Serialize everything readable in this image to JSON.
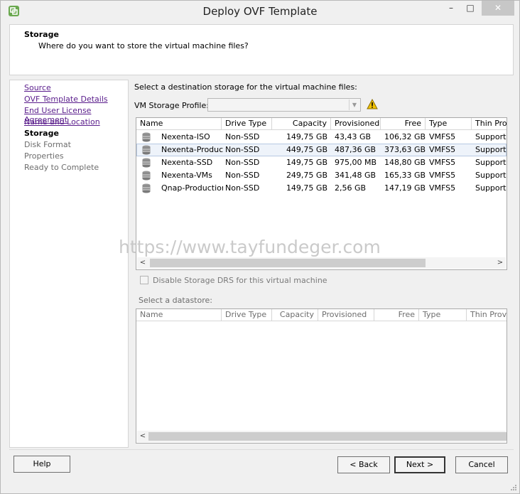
{
  "window": {
    "title": "Deploy OVF Template",
    "minimize": "–",
    "maximize": "□",
    "close": "✕"
  },
  "header": {
    "title": "Storage",
    "subtitle": "Where do you want to store the virtual machine files?"
  },
  "nav": {
    "items": [
      {
        "label": "Source",
        "state": "link"
      },
      {
        "label": "OVF Template Details",
        "state": "link"
      },
      {
        "label": "End User License Agreement",
        "state": "link"
      },
      {
        "label": "Name and Location",
        "state": "link"
      },
      {
        "label": "Storage",
        "state": "current"
      },
      {
        "label": "Disk Format",
        "state": "future"
      },
      {
        "label": "Properties",
        "state": "future"
      },
      {
        "label": "Ready to Complete",
        "state": "future"
      }
    ]
  },
  "main": {
    "prompt": "Select a destination storage for the virtual machine files:",
    "profile_label": "VM Storage Profile:",
    "profile_value": "",
    "columns": [
      "Name",
      "Drive Type",
      "Capacity",
      "Provisioned",
      "Free",
      "Type",
      "Thin Prov"
    ],
    "rows": [
      {
        "name": "Nexenta-ISO",
        "drive": "Non-SSD",
        "capacity": "149,75 GB",
        "provisioned": "43,43 GB",
        "free": "106,32 GB",
        "type": "VMFS5",
        "thin": "Supported"
      },
      {
        "name": "Nexenta-Production",
        "drive": "Non-SSD",
        "capacity": "449,75 GB",
        "provisioned": "487,36 GB",
        "free": "373,63 GB",
        "type": "VMFS5",
        "thin": "Supported"
      },
      {
        "name": "Nexenta-SSD",
        "drive": "Non-SSD",
        "capacity": "149,75 GB",
        "provisioned": "975,00 MB",
        "free": "148,80 GB",
        "type": "VMFS5",
        "thin": "Supported"
      },
      {
        "name": "Nexenta-VMs",
        "drive": "Non-SSD",
        "capacity": "249,75 GB",
        "provisioned": "341,48 GB",
        "free": "165,33 GB",
        "type": "VMFS5",
        "thin": "Supported"
      },
      {
        "name": "Qnap-Production",
        "drive": "Non-SSD",
        "capacity": "149,75 GB",
        "provisioned": "2,56 GB",
        "free": "147,19 GB",
        "type": "VMFS5",
        "thin": "Supported"
      }
    ],
    "selected_row": 1,
    "watermark": "https://www.tayfundeger.com",
    "drs_label": "Disable Storage DRS for this virtual machine",
    "select_datastore_label": "Select a datastore:",
    "columns2": [
      "Name",
      "Drive Type",
      "Capacity",
      "Provisioned",
      "Free",
      "Type",
      "Thin Provi"
    ]
  },
  "footer": {
    "help": "Help",
    "back": "< Back",
    "next": "Next >",
    "cancel": "Cancel"
  },
  "icons": {
    "app": "vsphere-app-icon",
    "warning": "warning-icon",
    "datastore": "datastore-icon"
  },
  "colors": {
    "link": "#5a1d8c",
    "selection": "#eef3fa",
    "warning": "#f2c200"
  }
}
